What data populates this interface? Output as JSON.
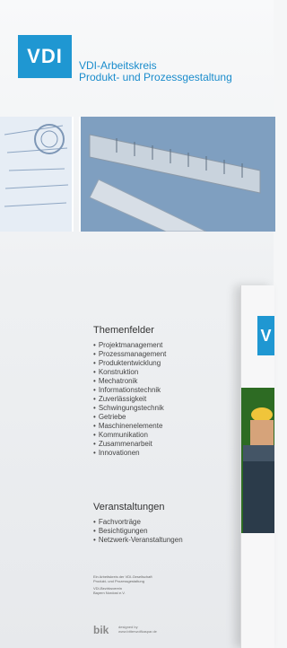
{
  "brand": {
    "logo_text": "VDI",
    "org_line1": "VDI-Arbeitskreis",
    "org_line2": "Produkt- und Prozessgestaltung",
    "brand_color": "#1f97d2"
  },
  "themenfelder": {
    "title": "Themenfelder",
    "items": [
      "Projektmanagement",
      "Prozessmanagement",
      "Produktentwicklung",
      "Konstruktion",
      "Mechatronik",
      "Informationstechnik",
      "Zuverlässigkeit",
      "Schwingungstechnik",
      "Getriebe",
      "Maschinenelemente",
      "Kommunikation",
      "Zusammenarbeit",
      "Innovationen"
    ]
  },
  "veranstaltungen": {
    "title": "Veranstaltungen",
    "items": [
      "Fachvorträge",
      "Besichtigungen",
      "Netzwerk-Veranstaltungen"
    ]
  },
  "footer": {
    "line1": "Ein Arbeitskreis der VDI-Gesellschaft",
    "line2": "Produkt- und Prozessgestaltung",
    "line3": "VDI-Bezirksverein",
    "line4": "Bayern Nordost e.V."
  },
  "designer": {
    "mark": "bik",
    "line1": "designed by",
    "line2": "www.bitterwolfkaspar.de"
  },
  "overlay": {
    "logo_letter": "V"
  }
}
